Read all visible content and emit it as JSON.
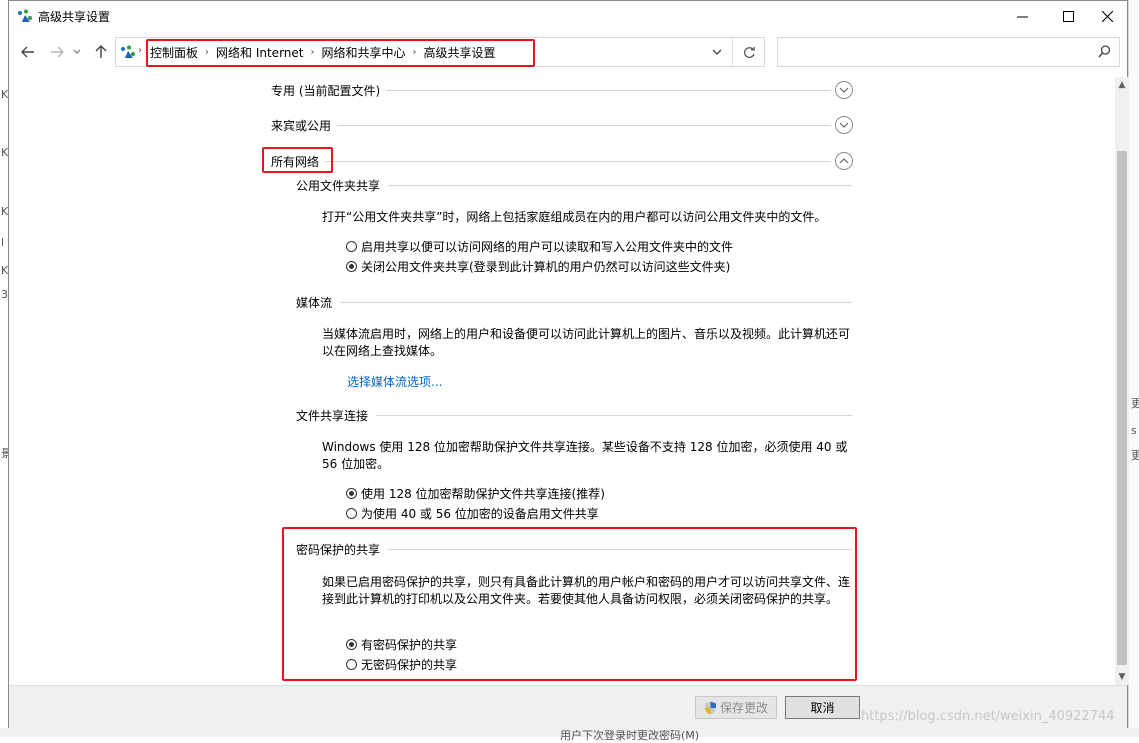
{
  "window": {
    "title": "高级共享设置"
  },
  "breadcrumb": [
    "控制面板",
    "网络和 Internet",
    "网络和共享中心",
    "高级共享设置"
  ],
  "search": {
    "placeholder": ""
  },
  "sections": {
    "private": {
      "label": "专用 (当前配置文件)"
    },
    "guest": {
      "label": "来宾或公用"
    },
    "all": {
      "label": "所有网络"
    }
  },
  "public_folder": {
    "heading": "公用文件夹共享",
    "desc": "打开“公用文件夹共享”时，网络上包括家庭组成员在内的用户都可以访问公用文件夹中的文件。",
    "options": [
      {
        "label": "启用共享以便可以访问网络的用户可以读取和写入公用文件夹中的文件",
        "checked": false
      },
      {
        "label": "关闭公用文件夹共享(登录到此计算机的用户仍然可以访问这些文件夹)",
        "checked": true
      }
    ]
  },
  "media": {
    "heading": "媒体流",
    "desc": "当媒体流启用时，网络上的用户和设备便可以访问此计算机上的图片、音乐以及视频。此计算机还可以在网络上查找媒体。",
    "link": "选择媒体流选项..."
  },
  "file_sharing": {
    "heading": "文件共享连接",
    "desc": "Windows 使用 128 位加密帮助保护文件共享连接。某些设备不支持 128 位加密，必须使用 40 或 56 位加密。",
    "options": [
      {
        "label": "使用 128 位加密帮助保护文件共享连接(推荐)",
        "checked": true
      },
      {
        "label": "为使用 40 或 56 位加密的设备启用文件共享",
        "checked": false
      }
    ]
  },
  "password": {
    "heading": "密码保护的共享",
    "desc": "如果已启用密码保护的共享，则只有具备此计算机的用户帐户和密码的用户才可以访问共享文件、连接到此计算机的打印机以及公用文件夹。若要使其他人具备访问权限，必须关闭密码保护的共享。",
    "options": [
      {
        "label": "有密码保护的共享",
        "checked": true
      },
      {
        "label": "无密码保护的共享",
        "checked": false
      }
    ]
  },
  "footer": {
    "save_label": "保存更改",
    "cancel_label": "取消"
  },
  "watermark": "https://blog.csdn.net/weixin_40922744",
  "background": {
    "bottom_text": "用户下次登录时更改密码(M)",
    "left_chars": [
      "K",
      "K",
      "K",
      "l",
      "K",
      "3",
      "景"
    ],
    "right_chars": [
      "更",
      "s",
      "更"
    ]
  },
  "colors": {
    "highlight_red": "#e8141c",
    "link_blue": "#0066cc"
  }
}
